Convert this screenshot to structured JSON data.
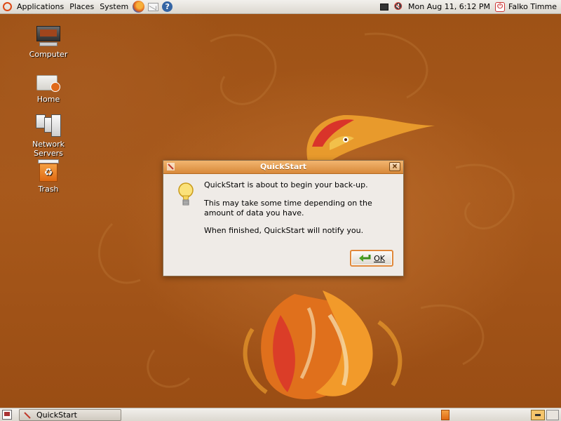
{
  "top_panel": {
    "menus": [
      "Applications",
      "Places",
      "System"
    ],
    "clock": "Mon Aug 11,  6:12 PM",
    "user": "Falko Timme"
  },
  "desktop_icons": [
    {
      "label": "Computer",
      "icon": "computer-icon"
    },
    {
      "label": "Home",
      "icon": "home-folder-icon"
    },
    {
      "label": "Network Servers",
      "icon": "network-servers-icon"
    },
    {
      "label": "Trash",
      "icon": "trash-icon"
    }
  ],
  "dialog": {
    "title": "QuickStart",
    "message_1": "QuickStart is about to begin your back-up.",
    "message_2": "This may take some time depending on the amount of data you have.",
    "message_3": "When finished, QuickStart will notify you.",
    "ok_label": "OK"
  },
  "bottom_panel": {
    "task_label": "QuickStart"
  },
  "colors": {
    "wallpaper": "#a85a1c",
    "titlebar": "#d8893a",
    "focus_border": "#e0883a"
  }
}
